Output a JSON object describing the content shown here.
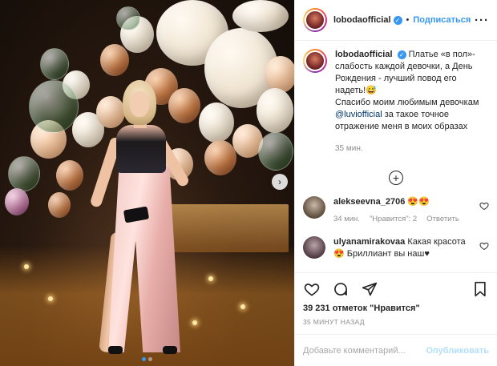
{
  "post": {
    "username": "lobodaofficial",
    "verified_glyph": "✓",
    "separator": "•",
    "follow_label": "Подписаться",
    "more_label": "···"
  },
  "caption": {
    "username": "lobodaofficial",
    "text": "Платье «в пол»- слабость каждой девочки, а День Рождения - лучший повод его надеть!😅\nСпасибо моим любимым девочкам ",
    "mention": "@luviofficial",
    "text_after": " за такое точное отражение меня в моих образах",
    "time": "35 мин."
  },
  "load_more_glyph": "+",
  "comments": [
    {
      "username": "alekseevna_2706",
      "text": "😍😍",
      "time": "34 мин.",
      "likes": "\"Нравится\": 2",
      "reply": "Ответить"
    },
    {
      "username": "ulyanamirakovaa",
      "text": "Какая красота 😍 Бриллиант вы наш♥"
    }
  ],
  "actions": {
    "likes": "39 231 отметок \"Нравится\"",
    "timestamp": "35 МИНУТ НАЗАД"
  },
  "add_comment": {
    "placeholder": "Добавьте комментарий...",
    "publish_label": "Опубликовать"
  },
  "carousel": {
    "next_glyph": "›",
    "slides_total": 2,
    "active_index": 0
  },
  "colors": {
    "accent": "#3897f0",
    "publish_disabled": "#b2dffc",
    "muted": "#8e8e8e"
  }
}
